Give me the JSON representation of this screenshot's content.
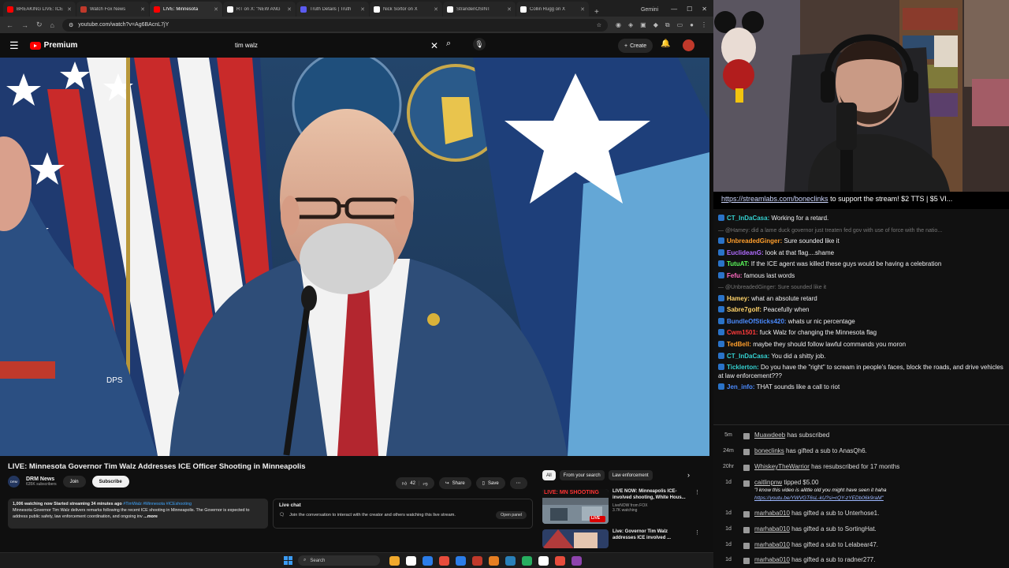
{
  "browser": {
    "tabs": [
      {
        "label": "BREAKING LIVE: ICE",
        "color": "#ff0000",
        "active": false
      },
      {
        "label": "Watch Fox News",
        "color": "#c0392b",
        "active": false
      },
      {
        "label": "LIVE: Minnesota",
        "color": "#ff0000",
        "active": true
      },
      {
        "label": "RT on X: \"NEW ANG",
        "color": "#ffffff",
        "active": false
      },
      {
        "label": "Truth Details | Truth",
        "color": "#5b5bf0",
        "active": false
      },
      {
        "label": "Nick Sortor on X",
        "color": "#ffffff",
        "active": false
      },
      {
        "label": "StrandenOSINT",
        "color": "#ffffff",
        "active": false
      },
      {
        "label": "Collin Rugg on X",
        "color": "#ffffff",
        "active": false
      }
    ],
    "new_tab": "+",
    "gemini": "Gemini",
    "url": "youtube.com/watch?v=Ag6BAcnL7jY"
  },
  "youtube": {
    "logo_text": "Premium",
    "search_value": "tim walz",
    "create_label": "Create"
  },
  "video": {
    "title": "LIVE: Minnesota Governor Tim Walz Addresses ICE Officer Shooting in Minneapolis",
    "dps_text": "DPS"
  },
  "channel": {
    "name": "DRM News",
    "subs": "635K subscribers",
    "join": "Join",
    "subscribe": "Subscribe",
    "avatar_text": "DRM"
  },
  "actions": {
    "likes": "42",
    "share": "Share",
    "save": "Save"
  },
  "description": {
    "meta": "1,006 watching now  Started streaming 34 minutes ago",
    "tags": "#TimWalz #Minnesota #ICEshooting",
    "body": "Minnesota Governor Tim Walz delivers remarks following the recent ICE shooting in Minneapolis. The Governor is expected to address public safety, law enforcement coordination, and ongoing inv",
    "more": "...more"
  },
  "livechat": {
    "title": "Live chat",
    "body": "Join the conversation to interact with the creator and others watching this live stream.",
    "open": "Open panel"
  },
  "chips": [
    "All",
    "From your search",
    "Law enforcement"
  ],
  "recommendations": [
    {
      "thumb_text": "LIVE: MN SHOOTING",
      "badge": "LIVE",
      "title": "LIVE NOW: Minneapolis ICE-involved shooting, White Hous...",
      "channel": "LiveNOW from FOX",
      "meta": "3.7K watching"
    },
    {
      "thumb_text": "",
      "badge": "",
      "title": "Live: Governor Tim Walz addresses ICE involved ...",
      "channel": "",
      "meta": ""
    }
  ],
  "taskbar": {
    "search": "Search",
    "apps": [
      "#f0a92d",
      "#ffffff",
      "#2b7de9",
      "#e74c3c",
      "#2b7de9",
      "#c0392b",
      "#e67e22",
      "#2980b9",
      "#27ae60",
      "#ffffff",
      "#e74c3c",
      "#8e44ad"
    ]
  },
  "chat": {
    "ticker_link": "https://streamlabs.com/boneclinks",
    "ticker_text": " to support the stream! $2 TTS | $5 VI...",
    "messages": [
      {
        "user": "CT_InDaCasa:",
        "color": "#34d1d1",
        "text": " Working for a retard.",
        "reply": ""
      },
      {
        "user": "",
        "color": "",
        "text": "",
        "reply": "— @Hamey: did a lame duck governor just treaten fed gov with use of force with the natio..."
      },
      {
        "user": "UnbreadedGinger:",
        "color": "#ff9e2c",
        "text": " Sure sounded like it",
        "reply": ""
      },
      {
        "user": "EuclideanG:",
        "color": "#b16cff",
        "text": " look at that flag....shame",
        "reply": ""
      },
      {
        "user": "TutuAT:",
        "color": "#5cfb5c",
        "text": " If the ICE agent was killed these guys would be having a celebration",
        "reply": ""
      },
      {
        "user": "Fefu:",
        "color": "#ff6ac1",
        "text": " famous last words",
        "reply": ""
      },
      {
        "user": "",
        "color": "",
        "text": "",
        "reply": "— @UnbreadedGinger: Sure sounded like it"
      },
      {
        "user": "Hamey:",
        "color": "#ffd36a",
        "text": " what an absolute retard",
        "reply": ""
      },
      {
        "user": "Sabre7golf:",
        "color": "#ffd36a",
        "text": " Peacefully when",
        "reply": ""
      },
      {
        "user": "BundleOfSticks420:",
        "color": "#4b8bff",
        "text": " whats ur nic percentage",
        "reply": ""
      },
      {
        "user": "Cwm1501:",
        "color": "#ff3b3b",
        "text": " fuck Walz for changing the Minnesota flag",
        "reply": ""
      },
      {
        "user": "TedBell:",
        "color": "#ff9e2c",
        "text": " maybe they should follow lawful commands you moron",
        "reply": ""
      },
      {
        "user": "CT_InDaCasa:",
        "color": "#34d1d1",
        "text": " You did a shitty job.",
        "reply": ""
      },
      {
        "user": "Ticklerton:",
        "color": "#34d1d1",
        "text": " Do you have the \"right\" to scream in people's faces, block the roads, and drive vehicles at law enforcement???",
        "reply": ""
      },
      {
        "user": "Jen_info:",
        "color": "#4b8bff",
        "text": " THAT sounds like a call to riot",
        "reply": ""
      }
    ]
  },
  "events": [
    {
      "time": "5m",
      "name": "Muawdeeb",
      "text": " has subscribed"
    },
    {
      "time": "24m",
      "name": "boneclinks",
      "text": " has gifted a sub to AnasQh6."
    },
    {
      "time": "20hr",
      "name": "WhiskeyTheWarrior",
      "text": " has resubscribed for 17 months"
    },
    {
      "time": "1d",
      "name": "caitlinpnw",
      "text": " tipped $5.00",
      "quote": "\"I know this video is alittle old you might have seen it haha",
      "link": "https://youtu.be/YWVGT6sL-kU?si=rQY-zYEDb06k9raM\""
    },
    {
      "time": "1d",
      "name": "marhaba010",
      "text": " has gifted a sub to Unterhose1."
    },
    {
      "time": "1d",
      "name": "marhaba010",
      "text": " has gifted a sub to SortingHat."
    },
    {
      "time": "1d",
      "name": "marhaba010",
      "text": " has gifted a sub to Lelabear47."
    },
    {
      "time": "1d",
      "name": "marhaba010",
      "text": " has gifted a sub to radner277."
    }
  ]
}
